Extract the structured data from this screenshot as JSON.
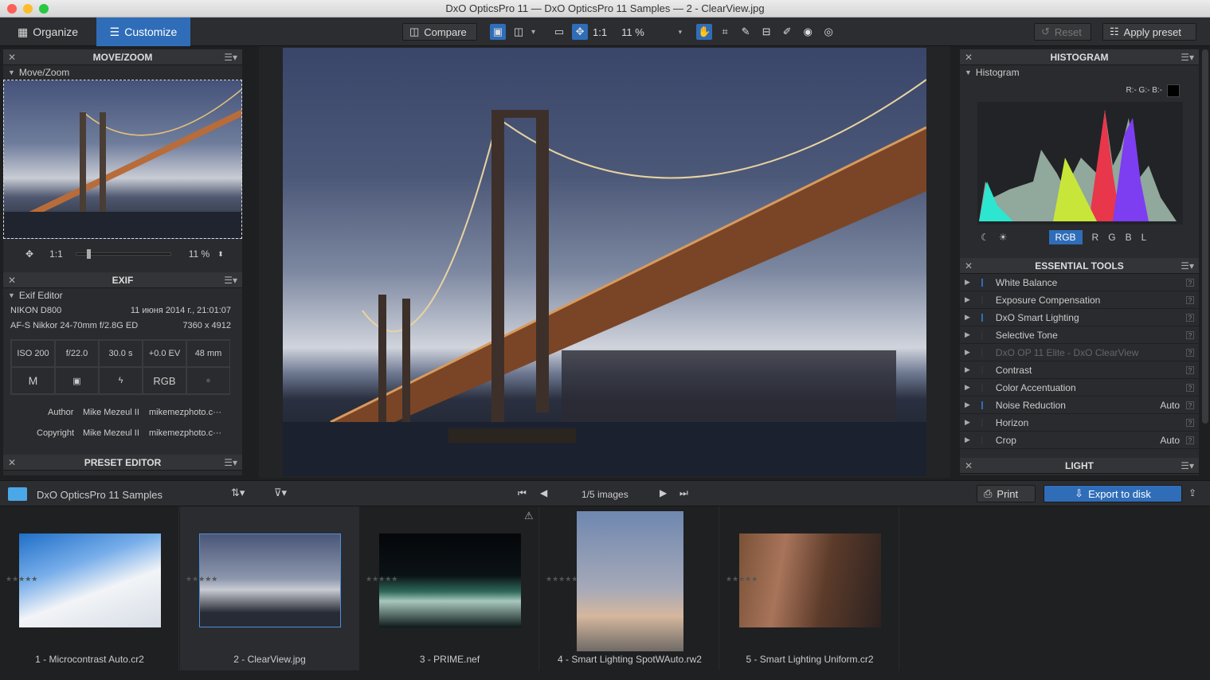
{
  "window": {
    "title": "DxO OpticsPro 11 — DxO OpticsPro 11 Samples — 2 - ClearView.jpg"
  },
  "tabs": [
    {
      "label": "Organize"
    },
    {
      "label": "Customize"
    }
  ],
  "toolbar": {
    "compare": "Compare",
    "one_to_one": "1:1",
    "zoom": "11 %",
    "reset": "Reset",
    "apply_preset": "Apply preset"
  },
  "move_zoom": {
    "title": "MOVE/ZOOM",
    "subtitle": "Move/Zoom",
    "one_to_one": "1:1",
    "zoom": "11 %",
    "zoom_level": 0.11
  },
  "exif": {
    "title": "EXIF",
    "subtitle": "Exif Editor",
    "camera": "NIKON D800",
    "date": "11 июня 2014 г., 21:01:07",
    "lens": "AF-S Nikkor 24-70mm f/2.8G ED",
    "dimensions": "7360 x 4912",
    "iso": "ISO 200",
    "aperture": "f/22.0",
    "shutter": "30.0 s",
    "ev": "+0.0 EV",
    "focal": "48 mm",
    "mode": "M",
    "color": "RGB",
    "author_label": "Author",
    "author_name": "Mike Mezeul II",
    "author_site": "mikemezphoto.c···",
    "copyright_label": "Copyright",
    "copyright_name": "Mike Mezeul II",
    "copyright_site": "mikemezphoto.c···"
  },
  "preset_editor": {
    "title": "PRESET EDITOR"
  },
  "histogram": {
    "title": "HISTOGRAM",
    "subtitle": "Histogram",
    "readout": "R:- G:- B:-",
    "channels": [
      "RGB",
      "R",
      "G",
      "B",
      "L"
    ]
  },
  "essential_tools": {
    "title": "ESSENTIAL TOOLS",
    "items": [
      {
        "label": "White Balance",
        "value": ""
      },
      {
        "label": "Exposure Compensation",
        "value": ""
      },
      {
        "label": "DxO Smart Lighting",
        "value": ""
      },
      {
        "label": "Selective Tone",
        "value": ""
      },
      {
        "label": "DxO OP 11 Elite - DxO ClearView",
        "value": ""
      },
      {
        "label": "Contrast",
        "value": ""
      },
      {
        "label": "Color Accentuation",
        "value": ""
      },
      {
        "label": "Noise Reduction",
        "value": "Auto"
      },
      {
        "label": "Horizon",
        "value": ""
      },
      {
        "label": "Crop",
        "value": "Auto"
      }
    ]
  },
  "light": {
    "title": "LIGHT"
  },
  "filmstrip": {
    "folder": "DxO OpticsPro 11 Samples",
    "count": "1/5 images",
    "print": "Print",
    "export": "Export to disk",
    "images": [
      {
        "name": "1 - Microcontrast Auto.cr2"
      },
      {
        "name": "2 - ClearView.jpg"
      },
      {
        "name": "3 - PRIME.nef"
      },
      {
        "name": "4 - Smart Lighting SpotWAuto.rw2"
      },
      {
        "name": "5 - Smart Lighting Uniform.cr2"
      }
    ]
  }
}
